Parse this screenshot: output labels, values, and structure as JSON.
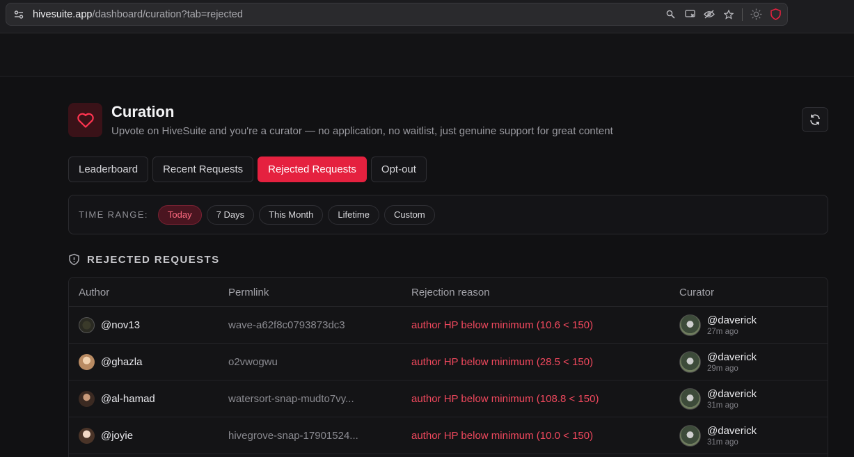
{
  "browser": {
    "url_host": "hivesuite.app",
    "url_path": "/dashboard/curation?tab=rejected"
  },
  "header": {
    "title": "Curation",
    "subtitle": "Upvote on HiveSuite and you're a curator — no application, no waitlist, just genuine support for great content",
    "icon": "heart-icon",
    "accent_color": "#e5213f"
  },
  "tabs": [
    {
      "label": "Leaderboard",
      "active": false
    },
    {
      "label": "Recent Requests",
      "active": false
    },
    {
      "label": "Rejected Requests",
      "active": true
    },
    {
      "label": "Opt-out",
      "active": false
    }
  ],
  "time_range": {
    "label": "TIME RANGE:",
    "options": [
      {
        "label": "Today",
        "active": true
      },
      {
        "label": "7 Days",
        "active": false
      },
      {
        "label": "This Month",
        "active": false
      },
      {
        "label": "Lifetime",
        "active": false
      },
      {
        "label": "Custom",
        "active": false
      }
    ]
  },
  "section": {
    "title": "REJECTED REQUESTS",
    "icon": "shield-icon"
  },
  "table": {
    "columns": [
      "Author",
      "Permlink",
      "Rejection reason",
      "Curator"
    ],
    "rows": [
      {
        "author": "@nov13",
        "permlink": "wave-a62f8c0793873dc3",
        "reason": "author HP below minimum (10.6 < 150)",
        "curator": "@daverick",
        "time": "27m ago"
      },
      {
        "author": "@ghazla",
        "permlink": "o2vwogwu",
        "reason": "author HP below minimum (28.5 < 150)",
        "curator": "@daverick",
        "time": "29m ago"
      },
      {
        "author": "@al-hamad",
        "permlink": "watersort-snap-mudto7vy...",
        "reason": "author HP below minimum (108.8 < 150)",
        "curator": "@daverick",
        "time": "31m ago"
      },
      {
        "author": "@joyie",
        "permlink": "hivegrove-snap-17901524...",
        "reason": "author HP below minimum (10.0 < 150)",
        "curator": "@daverick",
        "time": "31m ago"
      }
    ]
  }
}
